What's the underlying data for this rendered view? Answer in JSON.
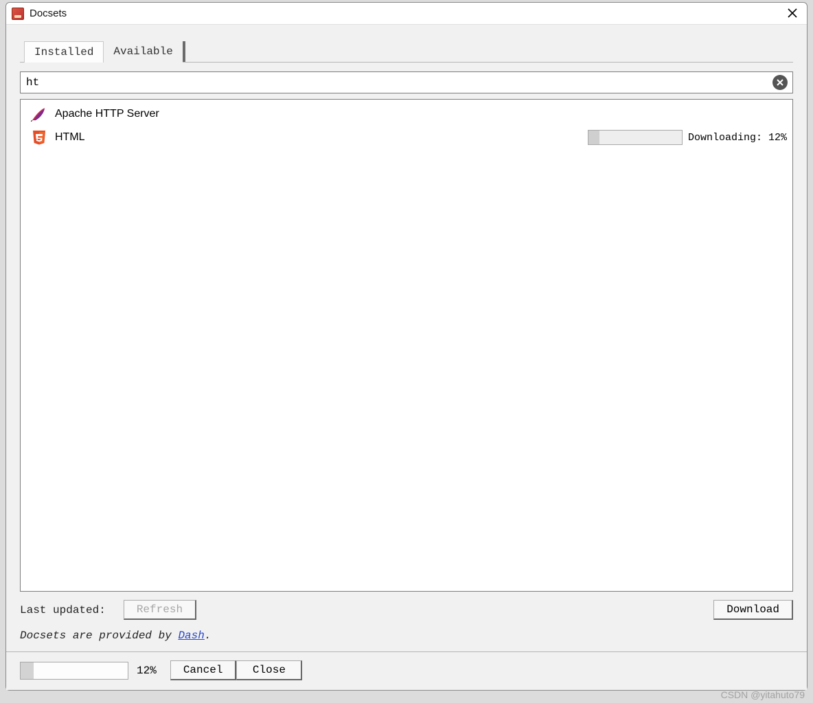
{
  "window": {
    "title": "Docsets"
  },
  "tabs": {
    "installed": "Installed",
    "available": "Available",
    "active": "available"
  },
  "search": {
    "value": "ht"
  },
  "results": [
    {
      "icon": "feather",
      "label": "Apache HTTP Server",
      "downloading": false
    },
    {
      "icon": "html5",
      "label": "HTML",
      "downloading": true,
      "progress_pct": 12,
      "status_text": "Downloading: 12%"
    }
  ],
  "footer": {
    "last_updated_label": "Last updated:",
    "refresh_label": "Refresh",
    "download_label": "Download",
    "provided_prefix": "Docsets are provided by ",
    "provided_link": "Dash",
    "provided_suffix": "."
  },
  "bottom": {
    "progress_pct": 12,
    "percent_label": "12%",
    "cancel_label": "Cancel",
    "close_label": "Close"
  },
  "watermark": "CSDN @yitahuto79"
}
